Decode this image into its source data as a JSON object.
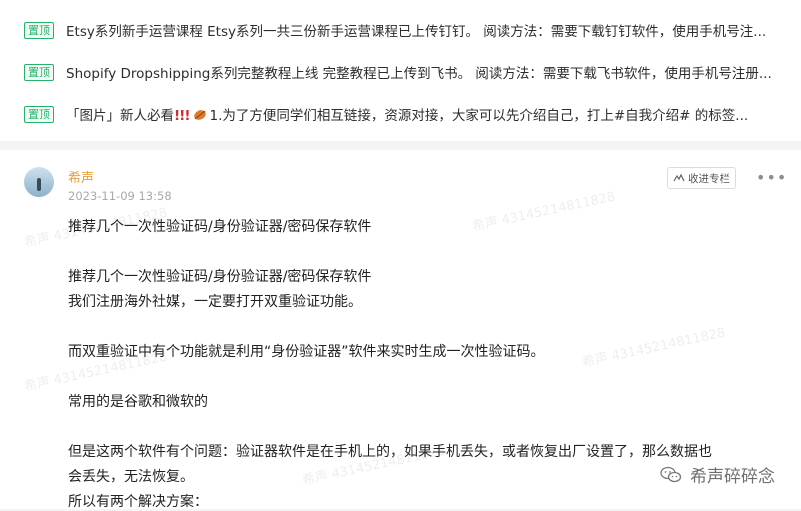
{
  "pinned": {
    "badge": "置顶",
    "items": [
      {
        "text": "Etsy系列新手运营课程 Etsy系列一共三份新手运营课程已上传钉钉。 阅读方法：需要下载钉钉软件，使用手机号注..."
      },
      {
        "text": "Shopify Dropshipping系列完整教程上线 完整教程已上传到飞书。 阅读方法：需要下载飞书软件，使用手机号注册..."
      },
      {
        "prefix": "「图片」新人必看",
        "marks": "!!!",
        "text": "1.为了方便同学们相互链接，资源对接，大家可以先介绍自己，打上#自我介绍# 的标签..."
      }
    ]
  },
  "post": {
    "author": "希声",
    "time": "2023-11-09 13:58",
    "collect_label": "收进专栏",
    "more_label": "•••",
    "lines": [
      "推荐几个一次性验证码/身份验证器/密码保存软件",
      "推荐几个一次性验证码/身份验证器/密码保存软件",
      "我们注册海外社媒，一定要打开双重验证功能。",
      "而双重验证中有个功能就是利用“身份验证器”软件来实时生成一次性验证码。",
      "常用的是谷歌和微软的",
      "但是这两个软件有个问题：验证器软件是在手机上的，如果手机丢失，或者恢复出厂设置了，那么数据也",
      "会丢失，无法恢复。",
      "所以有两个解决方案："
    ]
  },
  "watermark": "希声 43145214811828",
  "brand": "希声碎碎念",
  "colors": {
    "badge": "#24b36b",
    "author": "#e8a03c"
  }
}
